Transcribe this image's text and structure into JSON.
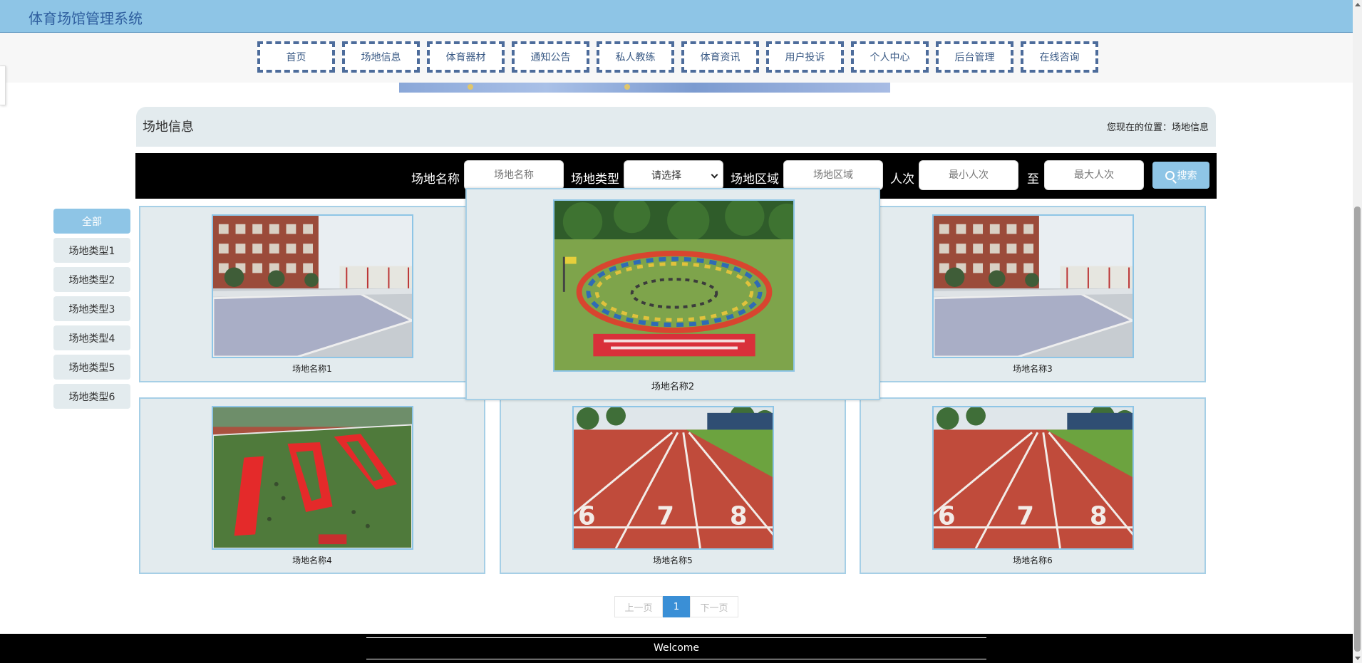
{
  "header": {
    "title": "体育场馆管理系统"
  },
  "nav": {
    "items": [
      "首页",
      "场地信息",
      "体育器材",
      "通知公告",
      "私人教练",
      "体育资讯",
      "用户投诉",
      "个人中心",
      "后台管理",
      "在线咨询"
    ]
  },
  "page": {
    "title": "场地信息",
    "breadcrumb": "您现在的位置：场地信息"
  },
  "search": {
    "name_label": "场地名称",
    "name_placeholder": "场地名称",
    "type_label": "场地类型",
    "type_selected": "请选择",
    "area_label": "场地区域",
    "area_placeholder": "场地区域",
    "count_label": "人次",
    "min_placeholder": "最小人次",
    "to_label": "至",
    "max_placeholder": "最大人次",
    "button_label": "搜索"
  },
  "categories": [
    "全部",
    "场地类型1",
    "场地类型2",
    "场地类型3",
    "场地类型4",
    "场地类型5",
    "场地类型6"
  ],
  "venues": [
    {
      "name": "场地名称1",
      "image": "court"
    },
    {
      "name": "场地名称2",
      "image": "lawn-circle"
    },
    {
      "name": "场地名称3",
      "image": "court"
    },
    {
      "name": "场地名称4",
      "image": "aerial-field"
    },
    {
      "name": "场地名称5",
      "image": "running-track"
    },
    {
      "name": "场地名称6",
      "image": "running-track"
    }
  ],
  "pager": {
    "prev": "上一页",
    "current": "1",
    "next": "下一页"
  },
  "footer": {
    "text": "Welcome"
  },
  "colors": {
    "accent": "#8ec5e6",
    "card_bg": "#e3ebee",
    "nav_border": "#4d6c9b",
    "pager_active": "#3a8fd6"
  }
}
